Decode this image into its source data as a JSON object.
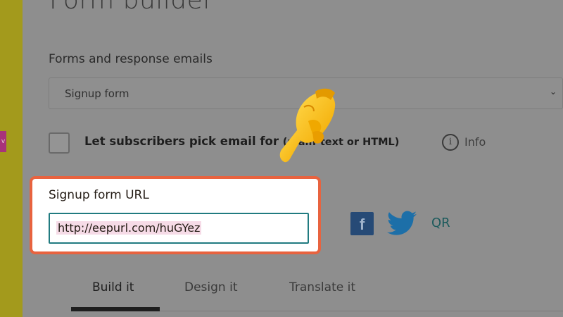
{
  "page": {
    "title": "Form builder",
    "sidebar_badge": "v"
  },
  "forms": {
    "section_label": "Forms and response emails",
    "select_value": "Signup form",
    "chevron_icon": "chevron-down-icon"
  },
  "format_option": {
    "checked": false,
    "label_main": "Let subscribers pick email for",
    "label_rest": "(plain-text or HTML)",
    "info_label": "Info"
  },
  "signup_url": {
    "label": "Signup form URL",
    "value": "http://eepurl.com/huGYez",
    "highlight_color": "#e8633f"
  },
  "share": {
    "facebook_glyph": "f",
    "twitter_icon": "twitter-bird-icon",
    "qr_label": "QR"
  },
  "tabs": [
    {
      "label": "Build it",
      "active": true
    },
    {
      "label": "Design it",
      "active": false
    },
    {
      "label": "Translate it",
      "active": false
    }
  ],
  "colors": {
    "accent_border": "#e8633f",
    "input_border": "#217b80",
    "sidebar": "#a39a1c"
  }
}
